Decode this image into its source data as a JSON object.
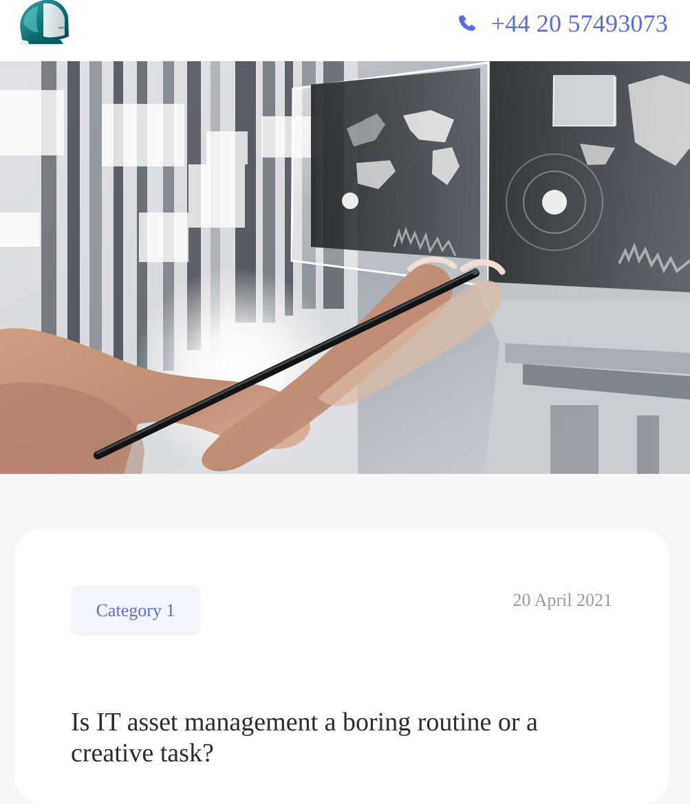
{
  "header": {
    "phone": "+44 20 57493073"
  },
  "hero": {
    "alt": "Hand holding a stylus near transparent digital screens with world maps"
  },
  "post": {
    "category": "Category 1",
    "date": "20 April 2021",
    "title": "Is IT asset management a boring routine or a creative task?"
  },
  "colors": {
    "accent": "#5a6fd6",
    "badge_bg": "#f3f5fe",
    "page_bg": "#f7f7f7",
    "date_text": "#9a9a9a",
    "title_text": "#2c2c2c"
  },
  "icons": {
    "logo": "computer-logo-icon",
    "phone": "phone-icon"
  }
}
